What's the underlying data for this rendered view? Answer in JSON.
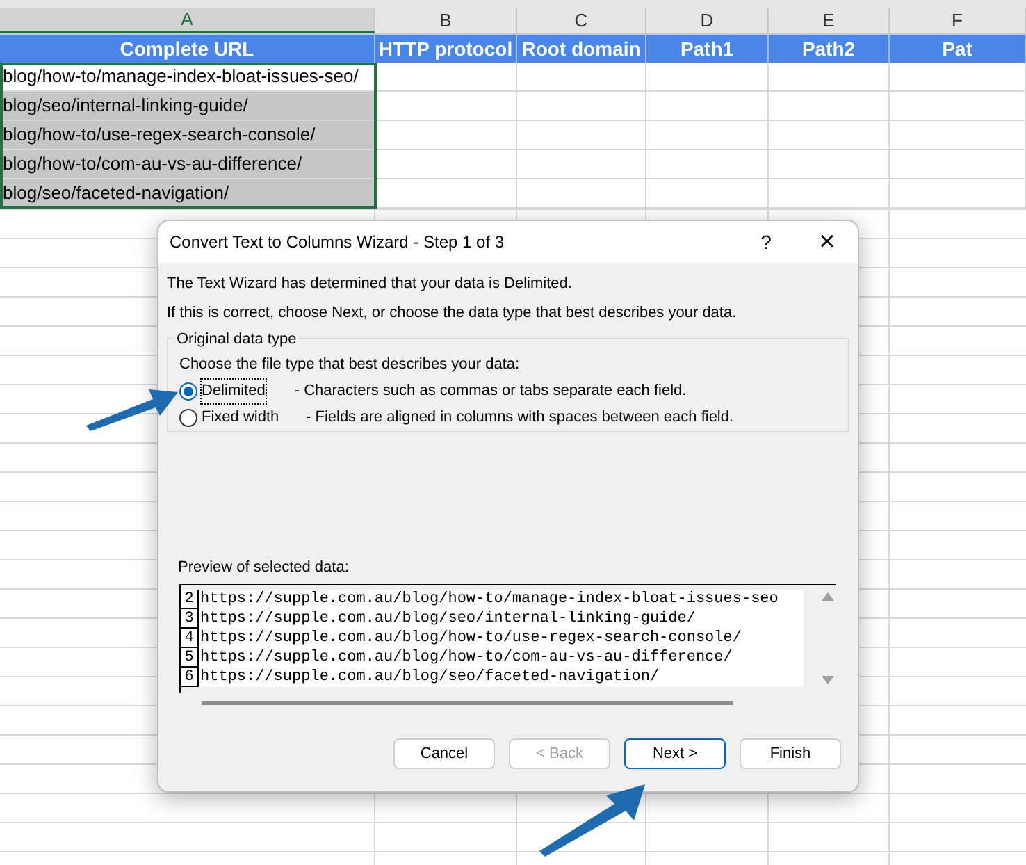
{
  "sheet": {
    "column_letters": [
      {
        "label": "A",
        "selected": true
      },
      {
        "label": "B",
        "selected": false
      },
      {
        "label": "C",
        "selected": false
      },
      {
        "label": "D",
        "selected": false
      },
      {
        "label": "E",
        "selected": false
      },
      {
        "label": "F",
        "selected": false
      }
    ],
    "headers": [
      "Complete URL",
      "HTTP protocol",
      "Root domain",
      "Path1",
      "Path2",
      "Pat"
    ],
    "rows": [
      {
        "url": "blog/how-to/manage-index-bloat-issues-seo/",
        "selected": false
      },
      {
        "url": "blog/seo/internal-linking-guide/",
        "selected": true
      },
      {
        "url": "blog/how-to/use-regex-search-console/",
        "selected": true
      },
      {
        "url": "blog/how-to/com-au-vs-au-difference/",
        "selected": true
      },
      {
        "url": "blog/seo/faceted-navigation/",
        "selected": true
      }
    ]
  },
  "dialog": {
    "title": "Convert Text to Columns Wizard - Step 1 of 3",
    "help": "?",
    "close": "×",
    "intro": [
      "The Text Wizard has determined that your data is Delimited.",
      "If this is correct, choose Next, or choose the data type that best describes your data."
    ],
    "group_label": "Original data type",
    "group_prompt": "Choose the file type that best describes your data:",
    "options": [
      {
        "label": "Delimited",
        "description": "- Characters such as commas or tabs separate each field.",
        "selected": true
      },
      {
        "label": "Fixed width",
        "description": "- Fields are aligned in columns with spaces between each field.",
        "selected": false
      }
    ],
    "preview_label": "Preview of selected data:",
    "preview_rows": [
      {
        "number": "2",
        "text": "https://supple.com.au/blog/how-to/manage-index-bloat-issues-seo"
      },
      {
        "number": "3",
        "text": "https://supple.com.au/blog/seo/internal-linking-guide/"
      },
      {
        "number": "4",
        "text": "https://supple.com.au/blog/how-to/use-regex-search-console/"
      },
      {
        "number": "5",
        "text": "https://supple.com.au/blog/how-to/com-au-vs-au-difference/"
      },
      {
        "number": "6",
        "text": "https://supple.com.au/blog/seo/faceted-navigation/"
      }
    ],
    "buttons": [
      {
        "label": "Cancel",
        "disabled": false,
        "default": false
      },
      {
        "label": "< Back",
        "disabled": true,
        "default": false
      },
      {
        "label": "Next >",
        "disabled": false,
        "default": true
      },
      {
        "label": "Finish",
        "disabled": false,
        "default": false
      }
    ]
  }
}
